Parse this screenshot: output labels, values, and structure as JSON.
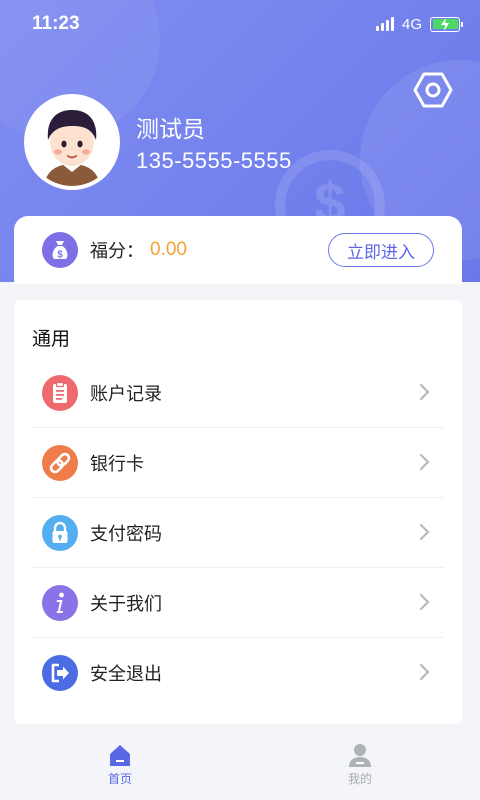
{
  "status_bar": {
    "time": "11:23",
    "network": "4G"
  },
  "profile": {
    "name": "测试员",
    "phone": "135-5555-5555"
  },
  "points": {
    "label": "福分：",
    "value": "0.00",
    "button_label": "立即进入"
  },
  "menu": {
    "section_title": "通用",
    "items": [
      {
        "label": "账户记录",
        "icon": "clipboard-icon",
        "color": "#ef6a6f"
      },
      {
        "label": "银行卡",
        "icon": "link-icon",
        "color": "#f07c4a"
      },
      {
        "label": "支付密码",
        "icon": "lock-icon",
        "color": "#53aef0"
      },
      {
        "label": "关于我们",
        "icon": "info-icon",
        "color": "#8a73e6"
      },
      {
        "label": "安全退出",
        "icon": "logout-icon",
        "color": "#4c6ce4"
      }
    ]
  },
  "tabbar": {
    "tabs": [
      {
        "label": "首页",
        "active": true
      },
      {
        "label": "我的",
        "active": false
      }
    ]
  },
  "colors": {
    "header": "#7382ee",
    "accent": "#5a68e6",
    "points_value": "#f4a13c"
  }
}
